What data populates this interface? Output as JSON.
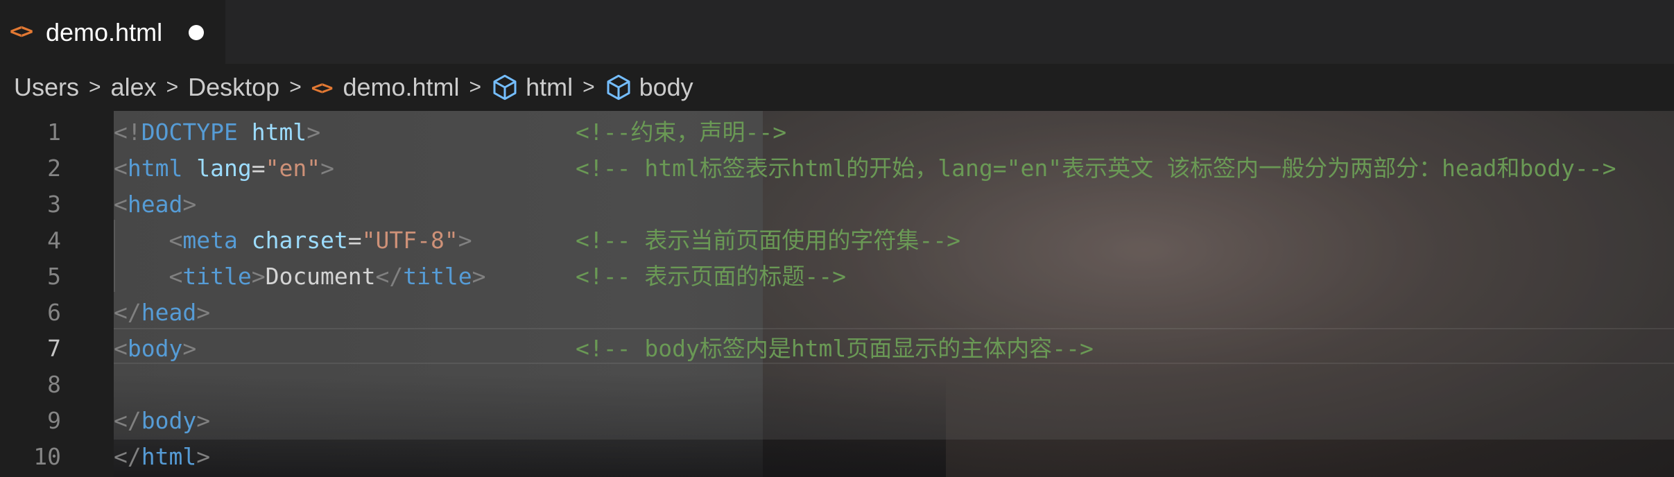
{
  "tab": {
    "icon": "<>",
    "label": "demo.html",
    "unsaved": true
  },
  "breadcrumb": {
    "items": [
      "Users",
      "alex",
      "Desktop",
      "demo.html",
      "html",
      "body"
    ],
    "separator": ">"
  },
  "editor": {
    "active_line": 7,
    "lines": [
      {
        "number": "1",
        "code": [
          {
            "text": "<!",
            "type": "punc"
          },
          {
            "text": "DOCTYPE",
            "type": "tag"
          },
          {
            "text": " ",
            "type": "text"
          },
          {
            "text": "html",
            "type": "attr"
          },
          {
            "text": ">",
            "type": "punc"
          }
        ],
        "comment": "<!--约束，声明-->"
      },
      {
        "number": "2",
        "code": [
          {
            "text": "<",
            "type": "punc"
          },
          {
            "text": "html",
            "type": "tag"
          },
          {
            "text": " ",
            "type": "text"
          },
          {
            "text": "lang",
            "type": "attr"
          },
          {
            "text": "=",
            "type": "eq"
          },
          {
            "text": "\"en\"",
            "type": "str"
          },
          {
            "text": ">",
            "type": "punc"
          }
        ],
        "comment": "<!-- html标签表示html的开始，lang=\"en\"表示英文 该标签内一般分为两部分：head和body-->"
      },
      {
        "number": "3",
        "code": [
          {
            "text": "<",
            "type": "punc"
          },
          {
            "text": "head",
            "type": "tag"
          },
          {
            "text": ">",
            "type": "punc"
          }
        ],
        "comment": ""
      },
      {
        "number": "4",
        "code": [
          {
            "text": "    ",
            "type": "text"
          },
          {
            "text": "<",
            "type": "punc"
          },
          {
            "text": "meta",
            "type": "tag"
          },
          {
            "text": " ",
            "type": "text"
          },
          {
            "text": "charset",
            "type": "attr"
          },
          {
            "text": "=",
            "type": "eq"
          },
          {
            "text": "\"UTF-8\"",
            "type": "str"
          },
          {
            "text": ">",
            "type": "punc"
          }
        ],
        "comment": "<!-- 表示当前页面使用的字符集-->"
      },
      {
        "number": "5",
        "code": [
          {
            "text": "    ",
            "type": "text"
          },
          {
            "text": "<",
            "type": "punc"
          },
          {
            "text": "title",
            "type": "tag"
          },
          {
            "text": ">",
            "type": "punc"
          },
          {
            "text": "Document",
            "type": "text"
          },
          {
            "text": "</",
            "type": "punc"
          },
          {
            "text": "title",
            "type": "tag"
          },
          {
            "text": ">",
            "type": "punc"
          }
        ],
        "comment": "<!-- 表示页面的标题-->"
      },
      {
        "number": "6",
        "code": [
          {
            "text": "</",
            "type": "punc"
          },
          {
            "text": "head",
            "type": "tag"
          },
          {
            "text": ">",
            "type": "punc"
          }
        ],
        "comment": ""
      },
      {
        "number": "7",
        "code": [
          {
            "text": "<",
            "type": "punc"
          },
          {
            "text": "body",
            "type": "tag"
          },
          {
            "text": ">",
            "type": "punc"
          }
        ],
        "comment": "<!-- body标签内是html页面显示的主体内容-->"
      },
      {
        "number": "8",
        "code": [],
        "comment": ""
      },
      {
        "number": "9",
        "code": [
          {
            "text": "</",
            "type": "punc"
          },
          {
            "text": "body",
            "type": "tag"
          },
          {
            "text": ">",
            "type": "punc"
          }
        ],
        "comment": ""
      },
      {
        "number": "10",
        "code": [
          {
            "text": "</",
            "type": "punc"
          },
          {
            "text": "html",
            "type": "tag"
          },
          {
            "text": ">",
            "type": "punc"
          }
        ],
        "comment": ""
      }
    ]
  },
  "colors": {
    "tag": "#569cd6",
    "attr": "#9cdcfe",
    "string": "#ce9178",
    "comment": "#6a9955",
    "html_icon": "#e37933",
    "symbol_icon": "#75beff"
  }
}
